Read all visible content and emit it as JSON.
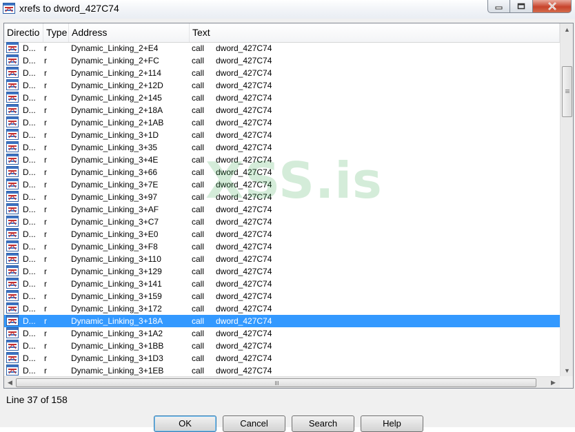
{
  "window": {
    "title": "xrefs to dword_427C74",
    "minimize_icon": "minimize-icon",
    "maximize_icon": "maximize-icon",
    "close_icon": "close-icon"
  },
  "columns": [
    "Directio",
    "Type",
    "Address",
    "Text"
  ],
  "rows": [
    {
      "dir": "D...",
      "type": "r",
      "address": "Dynamic_Linking_2+E4",
      "op": "call",
      "operand": "dword_427C74"
    },
    {
      "dir": "D...",
      "type": "r",
      "address": "Dynamic_Linking_2+FC",
      "op": "call",
      "operand": "dword_427C74"
    },
    {
      "dir": "D...",
      "type": "r",
      "address": "Dynamic_Linking_2+114",
      "op": "call",
      "operand": "dword_427C74"
    },
    {
      "dir": "D...",
      "type": "r",
      "address": "Dynamic_Linking_2+12D",
      "op": "call",
      "operand": "dword_427C74"
    },
    {
      "dir": "D...",
      "type": "r",
      "address": "Dynamic_Linking_2+145",
      "op": "call",
      "operand": "dword_427C74"
    },
    {
      "dir": "D...",
      "type": "r",
      "address": "Dynamic_Linking_2+18A",
      "op": "call",
      "operand": "dword_427C74"
    },
    {
      "dir": "D...",
      "type": "r",
      "address": "Dynamic_Linking_2+1AB",
      "op": "call",
      "operand": "dword_427C74"
    },
    {
      "dir": "D...",
      "type": "r",
      "address": "Dynamic_Linking_3+1D",
      "op": "call",
      "operand": "dword_427C74"
    },
    {
      "dir": "D...",
      "type": "r",
      "address": "Dynamic_Linking_3+35",
      "op": "call",
      "operand": "dword_427C74"
    },
    {
      "dir": "D...",
      "type": "r",
      "address": "Dynamic_Linking_3+4E",
      "op": "call",
      "operand": "dword_427C74"
    },
    {
      "dir": "D...",
      "type": "r",
      "address": "Dynamic_Linking_3+66",
      "op": "call",
      "operand": "dword_427C74"
    },
    {
      "dir": "D...",
      "type": "r",
      "address": "Dynamic_Linking_3+7E",
      "op": "call",
      "operand": "dword_427C74"
    },
    {
      "dir": "D...",
      "type": "r",
      "address": "Dynamic_Linking_3+97",
      "op": "call",
      "operand": "dword_427C74"
    },
    {
      "dir": "D...",
      "type": "r",
      "address": "Dynamic_Linking_3+AF",
      "op": "call",
      "operand": "dword_427C74"
    },
    {
      "dir": "D...",
      "type": "r",
      "address": "Dynamic_Linking_3+C7",
      "op": "call",
      "operand": "dword_427C74"
    },
    {
      "dir": "D...",
      "type": "r",
      "address": "Dynamic_Linking_3+E0",
      "op": "call",
      "operand": "dword_427C74"
    },
    {
      "dir": "D...",
      "type": "r",
      "address": "Dynamic_Linking_3+F8",
      "op": "call",
      "operand": "dword_427C74"
    },
    {
      "dir": "D...",
      "type": "r",
      "address": "Dynamic_Linking_3+110",
      "op": "call",
      "operand": "dword_427C74"
    },
    {
      "dir": "D...",
      "type": "r",
      "address": "Dynamic_Linking_3+129",
      "op": "call",
      "operand": "dword_427C74"
    },
    {
      "dir": "D...",
      "type": "r",
      "address": "Dynamic_Linking_3+141",
      "op": "call",
      "operand": "dword_427C74"
    },
    {
      "dir": "D...",
      "type": "r",
      "address": "Dynamic_Linking_3+159",
      "op": "call",
      "operand": "dword_427C74"
    },
    {
      "dir": "D...",
      "type": "r",
      "address": "Dynamic_Linking_3+172",
      "op": "call",
      "operand": "dword_427C74"
    },
    {
      "dir": "D...",
      "type": "r",
      "address": "Dynamic_Linking_3+18A",
      "op": "call",
      "operand": "dword_427C74",
      "selected": true
    },
    {
      "dir": "D...",
      "type": "r",
      "address": "Dynamic_Linking_3+1A2",
      "op": "call",
      "operand": "dword_427C74"
    },
    {
      "dir": "D...",
      "type": "r",
      "address": "Dynamic_Linking_3+1BB",
      "op": "call",
      "operand": "dword_427C74"
    },
    {
      "dir": "D...",
      "type": "r",
      "address": "Dynamic_Linking_3+1D3",
      "op": "call",
      "operand": "dword_427C74"
    },
    {
      "dir": "D...",
      "type": "r",
      "address": "Dynamic_Linking_3+1EB",
      "op": "call",
      "operand": "dword_427C74"
    }
  ],
  "status": "Line 37 of 158",
  "buttons": {
    "ok": "OK",
    "cancel": "Cancel",
    "search": "Search",
    "help": "Help"
  },
  "watermark": "XSS.is",
  "colors": {
    "selection": "#3399ff",
    "close_button": "#c7432c"
  }
}
